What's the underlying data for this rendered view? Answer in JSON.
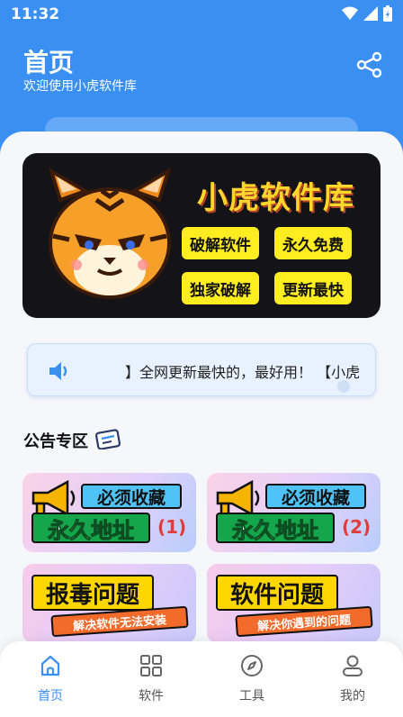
{
  "status_bar": {
    "time": "11:32"
  },
  "header": {
    "title": "首页",
    "subtitle": "欢迎使用小虎软件库",
    "share_icon": "share-icon",
    "color": "#3a8ff3"
  },
  "banner": {
    "title": "小虎软件库",
    "badges": [
      "破解软件",
      "永久免费",
      "独家破解",
      "更新最快"
    ]
  },
  "notice": {
    "icon": "speaker-icon",
    "text": "】全网更新最快的，最好用！ 【小虎"
  },
  "announcements": {
    "title": "公告专区",
    "cards": [
      {
        "top_label": "必须收藏",
        "main_label": "永久地址",
        "number": "(1)"
      },
      {
        "top_label": "必须收藏",
        "main_label": "永久地址",
        "number": "(2)"
      },
      {
        "main_label": "报毒问题",
        "sub_label": "解决软件无法安装"
      },
      {
        "main_label": "软件问题",
        "sub_label": "解决你遇到的问题"
      }
    ]
  },
  "tabbar": {
    "items": [
      {
        "label": "首页",
        "icon": "home-icon",
        "active": true
      },
      {
        "label": "软件",
        "icon": "grid-icon",
        "active": false
      },
      {
        "label": "工具",
        "icon": "compass-icon",
        "active": false
      },
      {
        "label": "我的",
        "icon": "user-icon",
        "active": false
      }
    ],
    "active_color": "#3a8ff3"
  }
}
